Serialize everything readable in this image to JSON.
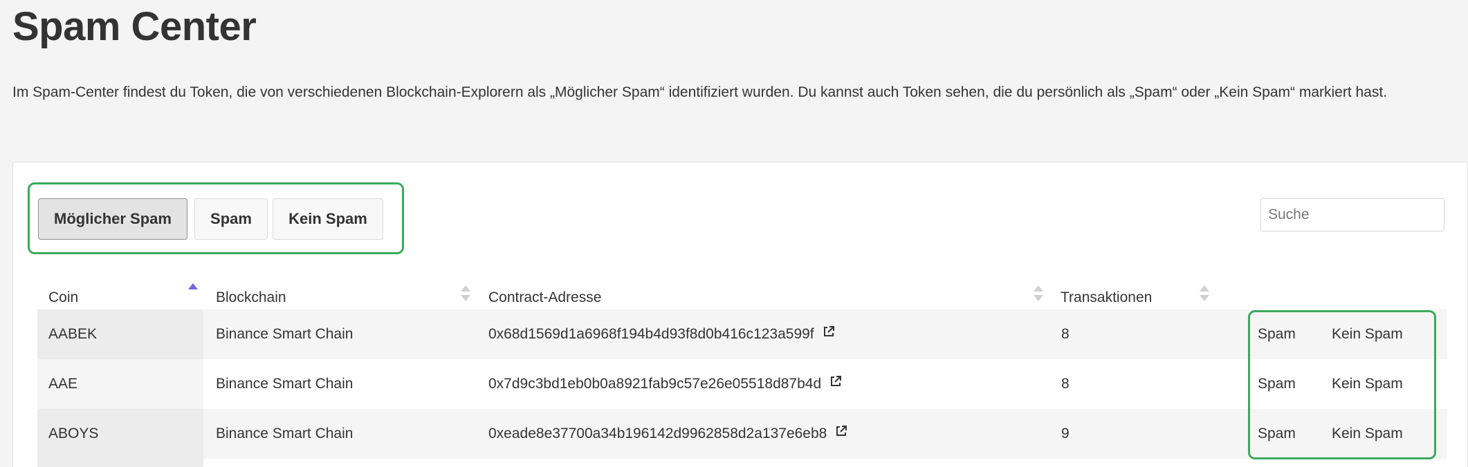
{
  "page": {
    "title": "Spam Center",
    "intro": "Im Spam-Center findest du Token, die von verschiedenen Blockchain-Explorern als „Möglicher Spam“ identifiziert wurden. Du kannst auch Token sehen, die du persönlich als „Spam“ oder „Kein Spam“ markiert hast."
  },
  "filters": {
    "tabs": [
      "Möglicher Spam",
      "Spam",
      "Kein Spam"
    ],
    "active": "Möglicher Spam"
  },
  "search": {
    "placeholder": "Suche",
    "value": ""
  },
  "table": {
    "columns": [
      "Coin",
      "Blockchain",
      "Contract-Adresse",
      "Transaktionen"
    ],
    "sorted_column": "Coin",
    "rows": [
      {
        "coin": "AABEK",
        "blockchain": "Binance Smart Chain",
        "contract": "0x68d1569d1a6968f194b4d93f8d0b416c123a599f",
        "transactions": "8",
        "action_spam": "Spam",
        "action_not_spam": "Kein Spam"
      },
      {
        "coin": "AAE",
        "blockchain": "Binance Smart Chain",
        "contract": "0x7d9c3bd1eb0b0a8921fab9c57e26e05518d87b4d",
        "transactions": "8",
        "action_spam": "Spam",
        "action_not_spam": "Kein Spam"
      },
      {
        "coin": "ABOYS",
        "blockchain": "Binance Smart Chain",
        "contract": "0xeade8e37700a34b196142d9962858d2a137e6eb8",
        "transactions": "9",
        "action_spam": "Spam",
        "action_not_spam": "Kein Spam"
      }
    ]
  },
  "icons": {
    "sort": "sort-icon",
    "external_link": "external-link-icon"
  },
  "colors": {
    "highlight_border": "#3aaa5c",
    "sort_active": "#6b6bd6",
    "active_tab_bg": "#e3e3e3"
  }
}
